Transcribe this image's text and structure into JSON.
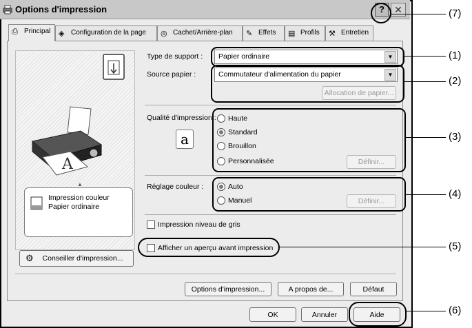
{
  "window": {
    "title": "Options d'impression",
    "help_glyph": "?",
    "close_glyph": "✕"
  },
  "tabs": [
    {
      "label": "Principal",
      "icon": "printer-icon"
    },
    {
      "label": "Configuration de la page",
      "icon": "layers-icon"
    },
    {
      "label": "Cachet/Arrière-plan",
      "icon": "stamp-icon"
    },
    {
      "label": "Effets",
      "icon": "brush-icon"
    },
    {
      "label": "Profils",
      "icon": "profile-icon"
    },
    {
      "label": "Entretien",
      "icon": "maintenance-icon"
    }
  ],
  "media": {
    "label": "Type de support :",
    "value": "Papier ordinaire"
  },
  "source": {
    "label": "Source papier :",
    "value": "Commutateur d'alimentation du papier",
    "alloc_button": "Allocation de papier..."
  },
  "quality": {
    "label": "Qualité d'impression :",
    "options": [
      "Haute",
      "Standard",
      "Brouillon",
      "Personnalisée"
    ],
    "selected": "Standard",
    "define_button": "Définir..."
  },
  "color": {
    "label": "Réglage couleur :",
    "options": [
      "Auto",
      "Manuel"
    ],
    "selected": "Auto",
    "define_button": "Définir..."
  },
  "grayscale": {
    "label": "Impression niveau de gris",
    "checked": false
  },
  "preview": {
    "label": "Afficher un aperçu avant impression",
    "checked": false
  },
  "info_box": {
    "line1": "Impression couleur",
    "line2": "Papier ordinaire"
  },
  "advisor_button": "Conseiller d'impression...",
  "bottom_buttons": {
    "print_options": "Options d'impression...",
    "about": "A propos de...",
    "defaults": "Défaut"
  },
  "dialog_buttons": {
    "ok": "OK",
    "cancel": "Annuler",
    "help": "Aide"
  },
  "callouts": [
    "(1)",
    "(2)",
    "(3)",
    "(4)",
    "(5)",
    "(6)",
    "(7)"
  ]
}
